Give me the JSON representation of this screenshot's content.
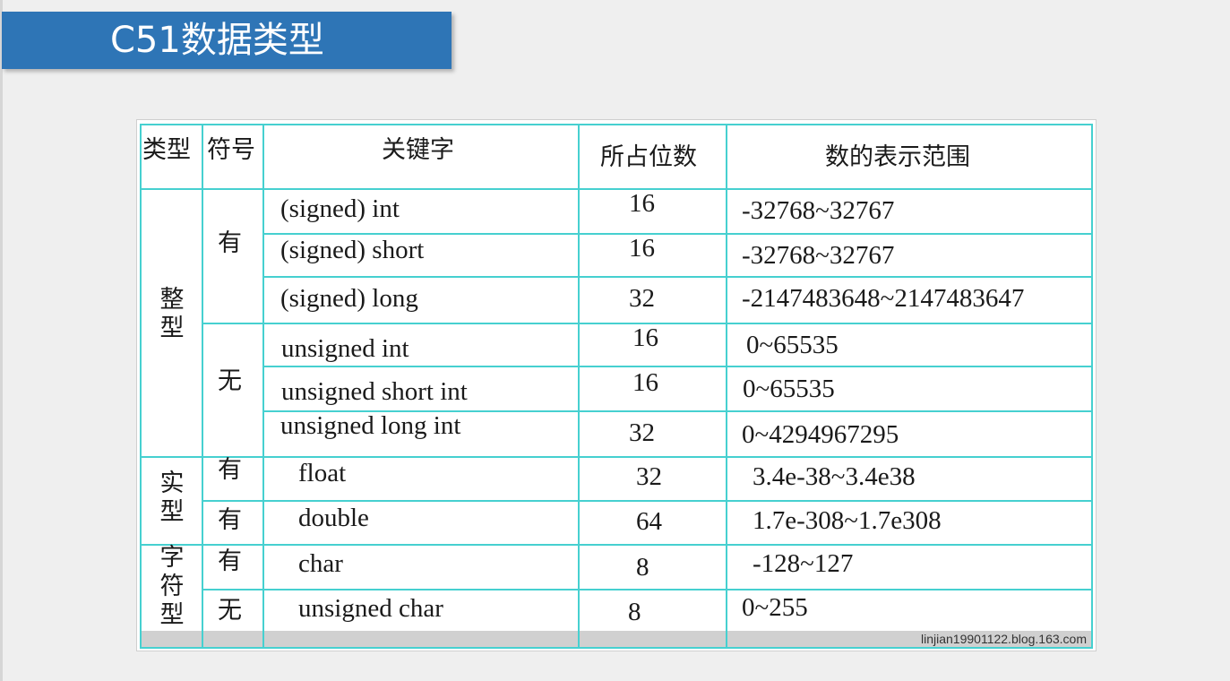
{
  "slide": {
    "title": "C51数据类型"
  },
  "table": {
    "headers": {
      "type": "类型",
      "sign": "符号",
      "keyword": "关键字",
      "bits": "所占位数",
      "range": "数的表示范围"
    },
    "groups": {
      "integer": "整型",
      "real": "实型",
      "char": "字符型"
    },
    "signs": {
      "int_signed": "有",
      "int_unsigned": "无",
      "float_signed": "有",
      "double_signed": "有",
      "char_signed": "有",
      "char_unsigned": "无"
    },
    "rows": [
      {
        "keyword": "(signed) int",
        "bits": "16",
        "range": "-32768~32767"
      },
      {
        "keyword": "(signed) short",
        "bits": "16",
        "range": "-32768~32767"
      },
      {
        "keyword": "(signed) long",
        "bits": "32",
        "range": "-2147483648~2147483647"
      },
      {
        "keyword": "unsigned int",
        "bits": "16",
        "range": "0~65535"
      },
      {
        "keyword": "unsigned short int",
        "bits": "16",
        "range": "0~65535"
      },
      {
        "keyword": "unsigned long int",
        "bits": "32",
        "range": "0~4294967295"
      },
      {
        "keyword": "float",
        "bits": "32",
        "range": "3.4e-38~3.4e38"
      },
      {
        "keyword": "double",
        "bits": "64",
        "range": "1.7e-308~1.7e308"
      },
      {
        "keyword": "char",
        "bits": "8",
        "range": "-128~127"
      },
      {
        "keyword": "unsigned char",
        "bits": "8",
        "range": "0~255"
      }
    ],
    "watermark": "linjian19901122.blog.163.com"
  },
  "colors": {
    "title_bar": "#2e75b6",
    "grid_line": "#46d0d0",
    "footer_band": "#d0d0d0"
  }
}
